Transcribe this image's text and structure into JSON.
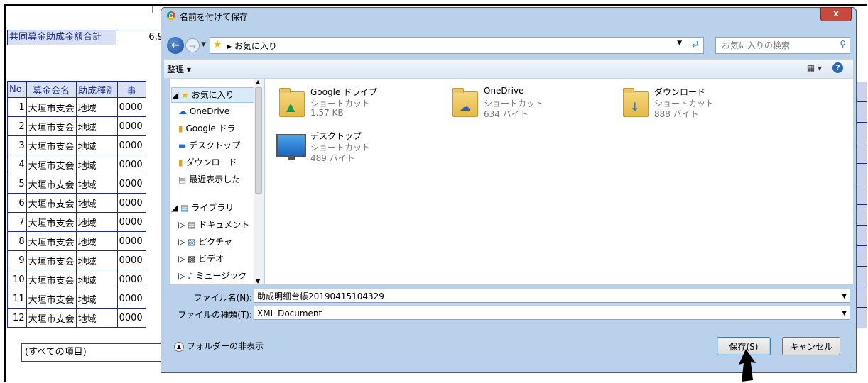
{
  "sheet": {
    "total_label": "共同募金助成金額合計",
    "total_value": "6,9",
    "headers": [
      "No.",
      "募金会名",
      "助成種別",
      "事"
    ],
    "rows": [
      {
        "no": "1",
        "name": "大垣市支会",
        "type": "地域",
        "code": "0000"
      },
      {
        "no": "2",
        "name": "大垣市支会",
        "type": "地域",
        "code": "0000"
      },
      {
        "no": "3",
        "name": "大垣市支会",
        "type": "地域",
        "code": "0000"
      },
      {
        "no": "4",
        "name": "大垣市支会",
        "type": "地域",
        "code": "0000"
      },
      {
        "no": "5",
        "name": "大垣市支会",
        "type": "地域",
        "code": "0000"
      },
      {
        "no": "6",
        "name": "大垣市支会",
        "type": "地域",
        "code": "0000"
      },
      {
        "no": "7",
        "name": "大垣市支会",
        "type": "地域",
        "code": "0000"
      },
      {
        "no": "8",
        "name": "大垣市支会",
        "type": "地域",
        "code": "0000"
      },
      {
        "no": "9",
        "name": "大垣市支会",
        "type": "地域",
        "code": "0000"
      },
      {
        "no": "10",
        "name": "大垣市支会",
        "type": "地域",
        "code": "0000"
      },
      {
        "no": "11",
        "name": "大垣市支会",
        "type": "地域",
        "code": "0000"
      },
      {
        "no": "12",
        "name": "大垣市支会",
        "type": "地域",
        "code": "0000"
      }
    ],
    "filter_value": "(すべての項目)"
  },
  "dialog": {
    "title": "名前を付けて保存",
    "close_label": "x",
    "breadcrumb": "お気に入り",
    "search_placeholder": "お気に入りの検索",
    "organize_label": "整理 ▾",
    "help_label": "?",
    "nav": {
      "favorites": "お気に入り",
      "onedrive": "OneDrive",
      "google_drive": "Google ドラ",
      "desktop": "デスクトップ",
      "downloads": "ダウンロード",
      "recent": "最近表示した",
      "libraries": "ライブラリ",
      "documents": "ドキュメント",
      "pictures": "ピクチャ",
      "videos": "ビデオ",
      "music": "ミュージック"
    },
    "files": [
      {
        "name": "Google ドライブ",
        "type": "ショートカット",
        "size": "1.57 KB"
      },
      {
        "name": "OneDrive",
        "type": "ショートカット",
        "size": "634 バイト"
      },
      {
        "name": "ダウンロード",
        "type": "ショートカット",
        "size": "888 バイト"
      },
      {
        "name": "デスクトップ",
        "type": "ショートカット",
        "size": "489 バイト"
      }
    ],
    "filename_label": "ファイル名(N):",
    "filename_value": "助成明細台帳20190415104329",
    "filetype_label": "ファイルの種類(T):",
    "filetype_value": "XML Document",
    "hide_folders_label": "フォルダーの非表示",
    "save_label": "保存(S)",
    "cancel_label": "キャンセル"
  },
  "colors": {
    "header_bg": "#d9e1f2",
    "border_blue": "#1b2a8c",
    "dialog_bg": "#b9d1ea"
  }
}
